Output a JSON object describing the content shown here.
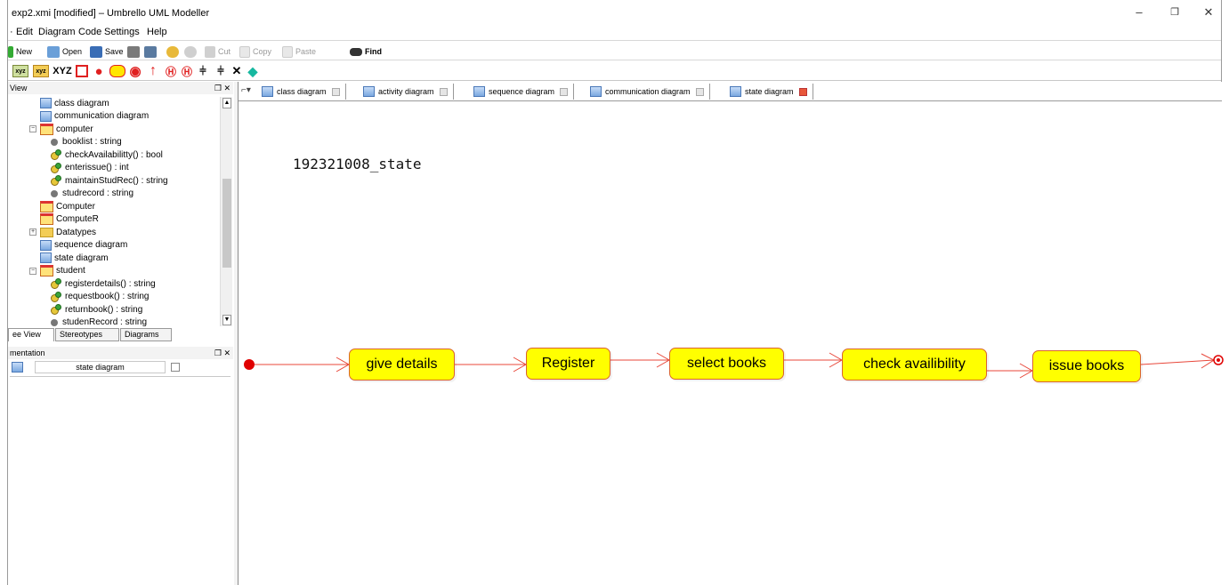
{
  "window": {
    "title": "exp2.xmi [modified] – Umbrello UML Modeller",
    "controls": [
      "–",
      "❐",
      "✕"
    ]
  },
  "menu": [
    "Edit",
    "Diagram",
    "Code",
    "Settings",
    "Help"
  ],
  "menu_partial_first": "",
  "toolbar": {
    "new": "New",
    "open": "Open",
    "save": "Save",
    "cut": "Cut",
    "copy": "Copy",
    "paste": "Paste",
    "find": "Find"
  },
  "toolbar2_glyphs": [
    "XYZ",
    "●",
    "◉",
    "↑",
    "Ⓗ",
    "Ⓗ",
    "⫩",
    "⫩",
    "✕",
    "◆"
  ],
  "tree_panel": {
    "header": "View",
    "items": [
      {
        "label": "class diagram",
        "icon": "diagram-icon",
        "indent": 2
      },
      {
        "label": "communication diagram",
        "icon": "diagram-icon",
        "indent": 2
      },
      {
        "label": "computer",
        "icon": "class-icon",
        "indent": 2,
        "expanded": true
      },
      {
        "label": "booklist : string",
        "icon": "attribute-icon",
        "indent": 3
      },
      {
        "label": "checkAvailabilitty() : bool",
        "icon": "operation-icon",
        "indent": 3
      },
      {
        "label": "enterissue() : int",
        "icon": "operation-icon",
        "indent": 3
      },
      {
        "label": "maintainStudRec() : string",
        "icon": "operation-icon",
        "indent": 3
      },
      {
        "label": "studrecord : string",
        "icon": "attribute-icon",
        "indent": 3
      },
      {
        "label": "Computer",
        "icon": "class-icon",
        "indent": 2
      },
      {
        "label": "ComputeR",
        "icon": "class-icon",
        "indent": 2
      },
      {
        "label": "Datatypes",
        "icon": "folder-icon",
        "indent": 2,
        "expandable": true
      },
      {
        "label": "sequence diagram",
        "icon": "diagram-icon",
        "indent": 2
      },
      {
        "label": "state diagram",
        "icon": "diagram-icon",
        "indent": 2
      },
      {
        "label": "student",
        "icon": "class-icon",
        "indent": 2,
        "expanded": true
      },
      {
        "label": "registerdetails() : string",
        "icon": "operation-icon",
        "indent": 3
      },
      {
        "label": "requestbook() : string",
        "icon": "operation-icon",
        "indent": 3
      },
      {
        "label": "returnbook() : string",
        "icon": "operation-icon",
        "indent": 3
      },
      {
        "label": "studenRecord : string",
        "icon": "attribute-icon",
        "indent": 3
      }
    ],
    "tabs": [
      "ee View",
      "Stereotypes",
      "Diagrams"
    ]
  },
  "doc_panel": {
    "header": "mentation",
    "field_value": "state diagram"
  },
  "doc_tabs": [
    {
      "label": "class diagram",
      "active": false
    },
    {
      "label": "activity diagram",
      "active": false
    },
    {
      "label": "sequence diagram",
      "active": false
    },
    {
      "label": "communication diagram",
      "active": false
    },
    {
      "label": "state diagram",
      "active": true
    }
  ],
  "diagram": {
    "title": "192321008_state",
    "states": [
      "give details",
      "Register",
      "select books",
      "check availibility",
      "issue books"
    ],
    "colors": {
      "state_fill": "#ffff00",
      "state_border": "#d9642e",
      "transition": "#e8473a",
      "initial": "#e00000"
    }
  }
}
